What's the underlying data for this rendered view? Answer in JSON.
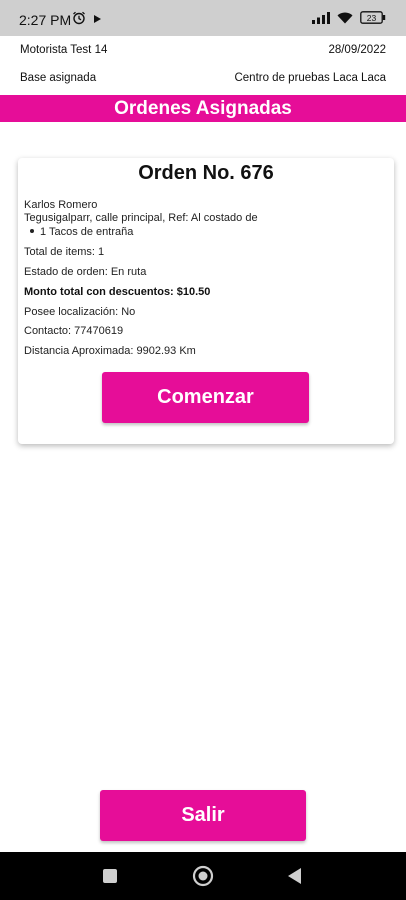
{
  "status_bar": {
    "time": "2:27 PM",
    "battery": "23",
    "left_icons": [
      "alarm-icon",
      "play-icon"
    ],
    "right_icons": [
      "signal-icon",
      "wifi-icon",
      "battery-icon"
    ]
  },
  "header": {
    "driver": "Motorista Test 14",
    "date": "28/09/2022",
    "base_label": "Base asignada",
    "base_value": "Centro de pruebas Laca Laca"
  },
  "page_title": "Ordenes Asignadas",
  "order_card": {
    "title": "Orden No. 676",
    "customer": "Karlos Romero",
    "address": "Tegusigalparr, calle principal, Ref: Al costado de",
    "items": [
      "1 Tacos de entraña"
    ],
    "total_items": "Total de items: 1",
    "status": "Estado de orden: En ruta",
    "total_discount": "Monto total con descuentos: $10.50",
    "location": "Posee localización: No",
    "contact": "Contacto: 77470619",
    "distance": "Distancia Aproximada: 9902.93 Km",
    "start_label": "Comenzar"
  },
  "exit_label": "Salir",
  "colors": {
    "accent": "#e60d98",
    "statusbar": "#cfcfcf",
    "navbar": "#000000"
  },
  "nav_bar": [
    "recents-square-icon",
    "home-circle-icon",
    "back-triangle-icon"
  ]
}
